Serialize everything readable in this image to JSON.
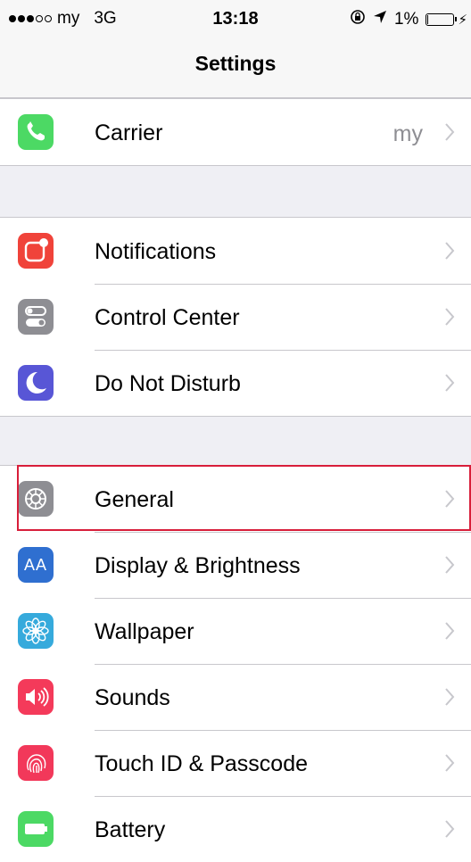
{
  "status_bar": {
    "carrier": "my",
    "network": "3G",
    "time": "13:18",
    "battery_percent": "1%",
    "battery_level": 0.01
  },
  "nav": {
    "title": "Settings"
  },
  "colors": {
    "phone": "#4cd964",
    "notifications": "#f0433a",
    "control_center": "#8e8e93",
    "do_not_disturb": "#5856d6",
    "general": "#8e8e93",
    "display": "#2f6fd0",
    "wallpaper": "#36aadc",
    "sounds": "#f43a5a",
    "touch_id": "#f2385a",
    "battery": "#4cd964",
    "highlight": "#d81e3a"
  },
  "groups": {
    "carrier": {
      "label": "Carrier",
      "value": "my",
      "icon": "phone-icon"
    },
    "notifications_group": [
      {
        "label": "Notifications",
        "icon": "notifications-icon"
      },
      {
        "label": "Control Center",
        "icon": "control-center-icon"
      },
      {
        "label": "Do Not Disturb",
        "icon": "moon-icon"
      }
    ],
    "general_group": [
      {
        "label": "General",
        "icon": "gear-icon"
      },
      {
        "label": "Display & Brightness",
        "icon": "text-size-icon",
        "icon_text": "AA"
      },
      {
        "label": "Wallpaper",
        "icon": "flower-icon"
      },
      {
        "label": "Sounds",
        "icon": "speaker-icon"
      },
      {
        "label": "Touch ID & Passcode",
        "icon": "fingerprint-icon"
      },
      {
        "label": "Battery",
        "icon": "battery-icon"
      }
    ]
  }
}
